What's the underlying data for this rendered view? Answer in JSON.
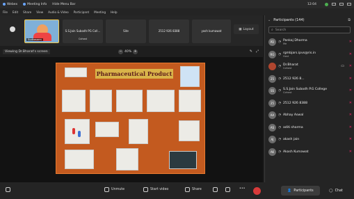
{
  "window": {
    "tabs": [
      "Webex",
      "Meeting Info",
      "Hide Menu Bar"
    ],
    "time": "12:04"
  },
  "menu": [
    "File",
    "Edit",
    "Share",
    "View",
    "Audio & Video",
    "Participant",
    "Meeting",
    "Help"
  ],
  "strip": {
    "self_label": "Sudhasarm",
    "tiles": [
      {
        "name": "S.S.Jain Subodh PG Coll...",
        "sub": "Cohost"
      },
      {
        "name": "",
        "sub": "Site"
      },
      {
        "name": "",
        "sub": "2512 926 8388"
      },
      {
        "name": "",
        "sub": "yash kumawat"
      }
    ],
    "layout_label": "Layout"
  },
  "viewbar": {
    "viewing_text": "Viewing Dr.Bharat's screen",
    "zoom_level": "40%",
    "zoom_out": "−",
    "zoom_in": "+"
  },
  "slide": {
    "title": "Pharmaceutical Product"
  },
  "bottombar": {
    "unmute": "Unmute",
    "start_video": "Start video",
    "share": "Share",
    "participants": "Participants",
    "chat": "Chat"
  },
  "panel": {
    "title": "Participants (144)",
    "search_placeholder": "Search",
    "participants": [
      {
        "name": "Pankaj Dharma",
        "role": "Me",
        "initials": "PD",
        "photo": false,
        "camera": false
      },
      {
        "name": "rgmbjars.ipvs@ris.in",
        "role": "Host",
        "initials": "RG",
        "photo": false,
        "camera": false
      },
      {
        "name": "Dr.Bharat",
        "role": "Cohost",
        "initials": "",
        "photo": true,
        "camera": true
      },
      {
        "name": "2512 926 8...",
        "role": "",
        "initials": "25",
        "photo": false,
        "camera": false
      },
      {
        "name": "S.S.Jain Subodh P.G College",
        "role": "Cohost",
        "initials": "SS",
        "photo": false,
        "camera": false
      },
      {
        "name": "2512 926 8388",
        "role": "",
        "initials": "25",
        "photo": false,
        "camera": false
      },
      {
        "name": "Abhay Aswal",
        "role": "",
        "initials": "AA",
        "photo": false,
        "camera": false
      },
      {
        "name": "aditi sharma",
        "role": "",
        "initials": "AS",
        "photo": false,
        "camera": false
      },
      {
        "name": "akash jain",
        "role": "",
        "initials": "AJ",
        "photo": false,
        "camera": false
      },
      {
        "name": "Akash Kumawat",
        "role": "",
        "initials": "AK",
        "photo": false,
        "camera": false
      }
    ]
  },
  "colors": {
    "accent": "#f2c94c",
    "end_button": "#d83a3a",
    "slide_background": "#c35a1f"
  }
}
